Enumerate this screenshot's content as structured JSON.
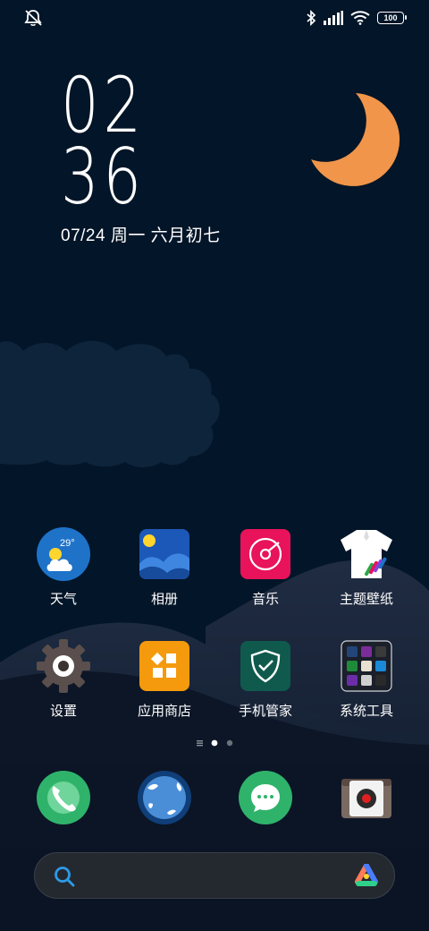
{
  "status_bar": {
    "left_icon": "mute-notification-icon",
    "right_icons": [
      "bluetooth-icon",
      "signal-icon",
      "wifi-icon"
    ],
    "battery": "100"
  },
  "clock": {
    "hours": "02",
    "minutes": "36",
    "date": "07/24 周一 六月初七"
  },
  "apps": [
    {
      "label": "天气",
      "icon": "weather-icon",
      "temp": "29°"
    },
    {
      "label": "相册",
      "icon": "gallery-icon"
    },
    {
      "label": "音乐",
      "icon": "music-icon"
    },
    {
      "label": "主题壁纸",
      "icon": "themes-icon"
    },
    {
      "label": "设置",
      "icon": "settings-icon"
    },
    {
      "label": "应用商店",
      "icon": "app-store-icon"
    },
    {
      "label": "手机管家",
      "icon": "phone-manager-icon"
    },
    {
      "label": "系统工具",
      "icon": "system-tools-folder-icon"
    }
  ],
  "page_indicator": {
    "pages": 2,
    "current": 1
  },
  "dock": [
    {
      "icon": "phone-icon"
    },
    {
      "icon": "browser-icon"
    },
    {
      "icon": "messages-icon"
    },
    {
      "icon": "camera-icon"
    }
  ],
  "search_bar": {
    "left_icon": "search-icon",
    "right_icon": "assistant-icon"
  },
  "colors": {
    "background": "#031528",
    "moon": "#f0954a",
    "hills": "#1c2a40"
  }
}
